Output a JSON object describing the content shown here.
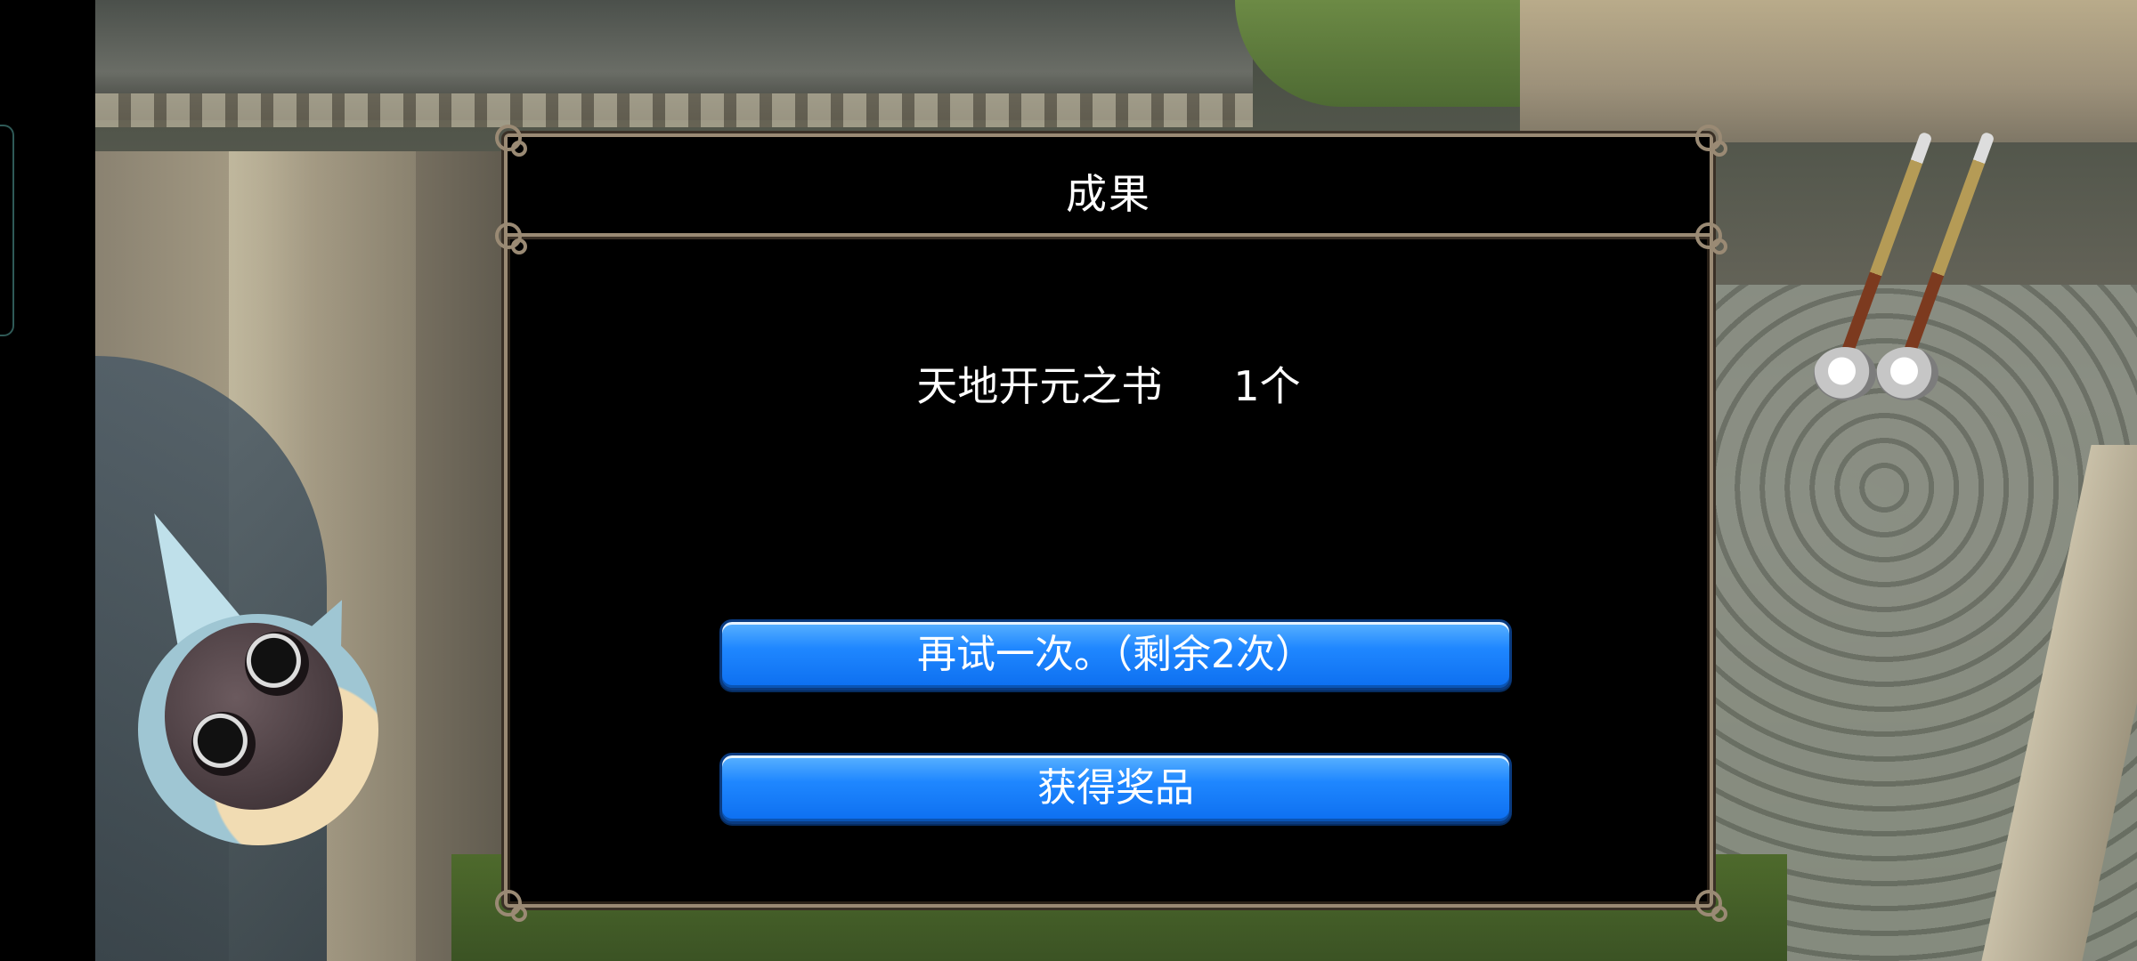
{
  "dialog": {
    "title": "成果",
    "reward": {
      "item_name": "天地开元之书",
      "quantity": "1个"
    },
    "buttons": {
      "retry_label": "再试一次。（剩余2次）",
      "claim_label": "获得奖品"
    }
  },
  "colors": {
    "button_blue": "#1f87ff",
    "frame_brown": "#9a8a74",
    "dialog_bg": "#000000",
    "text_white": "#ffffff"
  }
}
